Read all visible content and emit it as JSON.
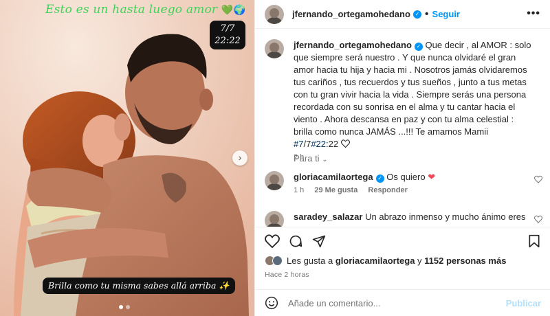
{
  "media": {
    "story_title": "Esto es un hasta luego amor",
    "story_title_emoji": "💚🌍",
    "time_badge_date": "7/7",
    "time_badge_time": "22:22",
    "caption_overlay": "Brilla como tu misma sabes allá arriba ✨",
    "carousel_position": 1,
    "carousel_total": 2
  },
  "header": {
    "username": "jfernando_ortegamohedano",
    "separator": "•",
    "follow_label": "Seguir",
    "more_label": "•••"
  },
  "caption": {
    "username": "jfernando_ortegamohedano",
    "text": "Que decir , al AMOR : solo que siempre será nuestro . Y que nunca olvidaré el gran amor hacia tu hija y hacia mi . Nosotros jamás olvidaremos tus cariños , tus recuerdos y tus sueños , junto a tus metas con tu gran vivir hacia la vida . Siempre serás una persona recordada con su sonrisa en el alma y tu cantar hacia el viento . Ahora descansa en paz y con tu alma celestial : brilla como nunca JAMÁS ...!!! Te amamos Mamii ",
    "tag1": "#7",
    "mid": "/7",
    "tag2": "#22",
    "end": ":22 ",
    "time": "2 h"
  },
  "sort_label": "Para ti",
  "comments": [
    {
      "username": "gloriacamilaortega",
      "text": "Os quiero ",
      "time": "1 h",
      "likes": "29 Me gusta",
      "reply": "Responder"
    },
    {
      "username": "saradey_salazar",
      "text": "Un abrazo inmenso y mucho ánimo eres un"
    }
  ],
  "likes": {
    "prefix": "Les gusta a ",
    "user": "gloriacamilaortega",
    "middle": " y ",
    "count": "1152 personas más"
  },
  "posted_ago": "Hace 2 horas",
  "add_comment": {
    "placeholder": "Añade un comentario...",
    "publish_label": "Publicar"
  },
  "colors": {
    "accent": "#0095f6",
    "title_green": "#3fd35a",
    "heart_red": "#ed4956",
    "publish_disabled": "#b2dffc"
  }
}
